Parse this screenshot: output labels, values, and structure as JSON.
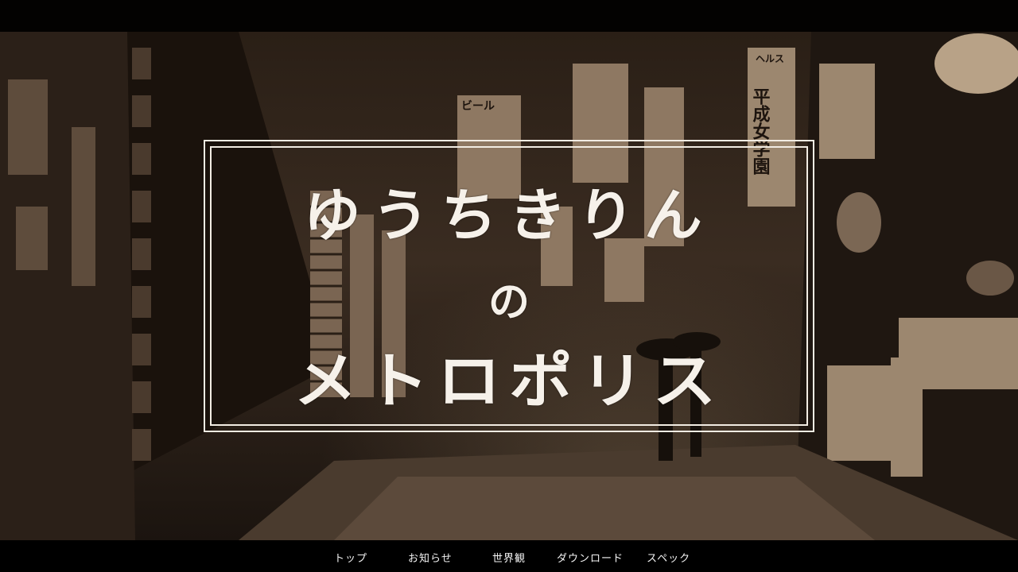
{
  "title": {
    "line1": "ゆうちきりん",
    "line2": "の",
    "line3": "メトロポリス"
  },
  "signs": {
    "heru": "ヘルス",
    "heisei": "平成女学園",
    "beer": "ビール"
  },
  "nav": {
    "items": [
      "トップ",
      "お知らせ",
      "世界観",
      "ダウンロード",
      "スペック"
    ]
  },
  "colors": {
    "background": "#000000",
    "sepia_dark": "#2a1f16",
    "sepia_light": "#c9b59b",
    "title_text": "#f6f1ea",
    "nav_text": "#f4f4f4"
  }
}
